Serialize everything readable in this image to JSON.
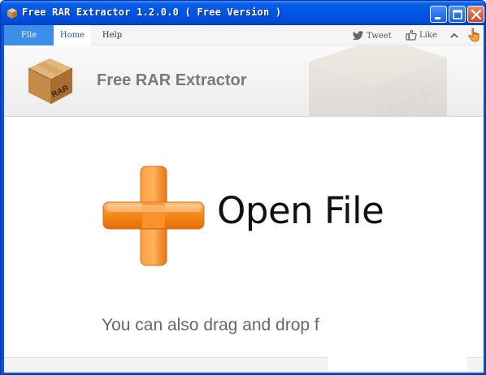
{
  "window": {
    "title": "Free RAR Extractor 1.2.0.0 ( Free Version )",
    "icon": "rar-box-icon"
  },
  "menu": {
    "file": "File",
    "home": "Home",
    "help": "Help",
    "tweet": "Tweet",
    "like": "Like"
  },
  "header": {
    "title": "Free RAR Extractor",
    "logo_text": "RAR"
  },
  "main": {
    "open_label": "Open File",
    "drag_hint": "You can also drag and drop f"
  },
  "colors": {
    "title_bar": "#0055e5",
    "accent": "#3d8ee8",
    "plus_orange": "#f48a1c"
  }
}
